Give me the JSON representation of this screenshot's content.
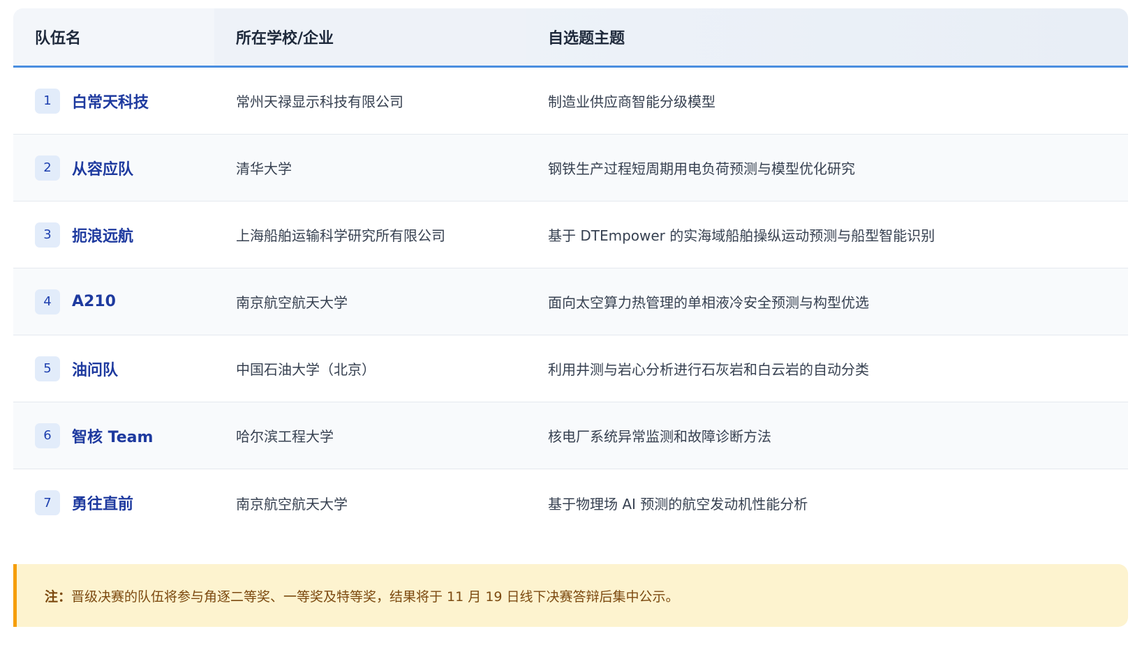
{
  "table": {
    "headers": [
      "队伍名",
      "所在学校/企业",
      "自选题主题"
    ],
    "rows": [
      {
        "rank": "1",
        "team": "白常天科技",
        "org": "常州天禄显示科技有限公司",
        "topic": "制造业供应商智能分级模型"
      },
      {
        "rank": "2",
        "team": "从容应队",
        "org": "清华大学",
        "topic": "钢铁生产过程短周期用电负荷预测与模型优化研究"
      },
      {
        "rank": "3",
        "team": "扼浪远航",
        "org": "上海船舶运输科学研究所有限公司",
        "topic": "基于 DTEmpower 的实海域船舶操纵运动预测与船型智能识别"
      },
      {
        "rank": "4",
        "team": "A210",
        "org": "南京航空航天大学",
        "topic": "面向太空算力热管理的单相液冷安全预测与构型优选"
      },
      {
        "rank": "5",
        "team": "油问队",
        "org": "中国石油大学（北京）",
        "topic": "利用井测与岩心分析进行石灰岩和白云岩的自动分类"
      },
      {
        "rank": "6",
        "team": "智核 Team",
        "org": "哈尔滨工程大学",
        "topic": "核电厂系统异常监测和故障诊断方法"
      },
      {
        "rank": "7",
        "team": "勇往直前",
        "org": "南京航空航天大学",
        "topic": "基于物理场 AI 预测的航空发动机性能分析"
      }
    ]
  },
  "note": {
    "label": "注：",
    "text": "晋级决赛的队伍将参与角逐二等奖、一等奖及特等奖，结果将于 11 月 19 日线下决赛答辩后集中公示。"
  },
  "colors": {
    "accent": "#4a8ee0",
    "team_name": "#1e3a9f",
    "note_bg": "#fdf3cf",
    "note_border": "#f59e0b"
  }
}
